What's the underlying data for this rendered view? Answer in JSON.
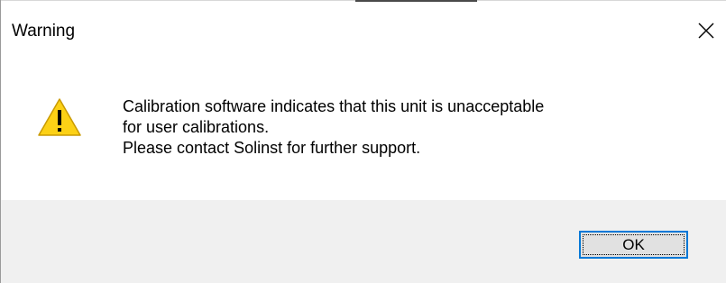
{
  "dialog": {
    "title": "Warning",
    "close_icon": "close-icon",
    "icon": "warning-triangle-icon",
    "message_lines": [
      "Calibration software indicates that this unit is unacceptable",
      "for user calibrations.",
      "Please contact Solinst for further support."
    ],
    "ok_label": "OK"
  },
  "colors": {
    "footer_bg": "#f0f0f0",
    "button_bg": "#e1e1e1",
    "button_focus_border": "#0078d7",
    "warning_yellow": "#fcd116"
  }
}
